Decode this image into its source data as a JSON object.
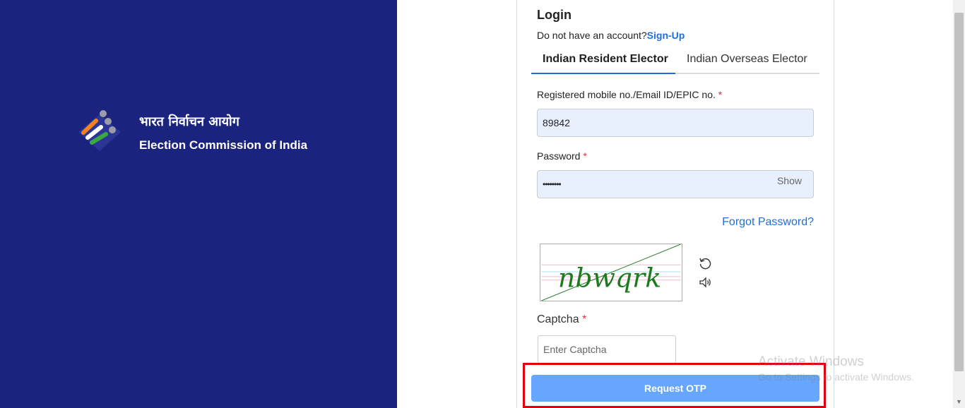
{
  "brand": {
    "hindi_name": "भारत निर्वाचन आयोग",
    "english_name": "Election Commission of India"
  },
  "login": {
    "title": "Login",
    "no_account_text": "Do not have an account?",
    "signup_label": "Sign-Up",
    "tabs": [
      {
        "label": "Indian Resident Elector",
        "active": true
      },
      {
        "label": "Indian Overseas Elector",
        "active": false
      }
    ],
    "id_field": {
      "label": "Registered mobile no./Email ID/EPIC no.",
      "required_mark": "*",
      "value": "89842"
    },
    "password_field": {
      "label": "Password",
      "required_mark": "*",
      "value": "••••••••",
      "show_label": "Show"
    },
    "forgot_label": "Forgot Password?",
    "captcha": {
      "image_text": "nbwqrk",
      "refresh_icon": "refresh-icon",
      "audio_icon": "speaker-icon",
      "label": "Captcha",
      "required_mark": "*",
      "placeholder": "Enter Captcha"
    },
    "submit_label": "Request OTP"
  },
  "watermark": {
    "title": "Activate Windows",
    "subtitle": "Go to Settings to activate Windows."
  },
  "colors": {
    "panel_bg": "#1a237e",
    "link": "#1e6fd9",
    "button_bg": "#66a6ff",
    "highlight": "#e4000f",
    "input_bg": "#e8f0fe"
  }
}
